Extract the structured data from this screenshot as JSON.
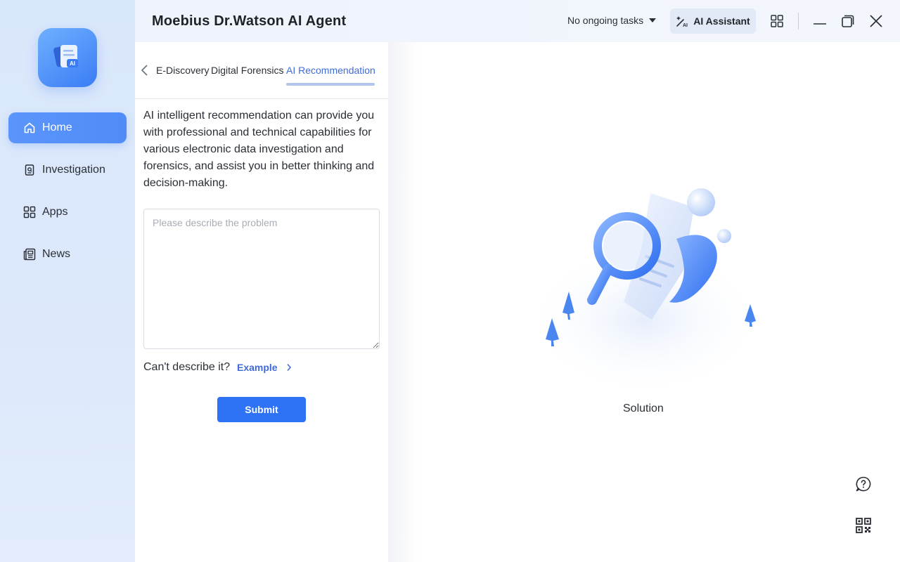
{
  "app": {
    "title": "Moebius Dr.Watson AI Agent"
  },
  "sidebar": {
    "logo_badge": "AI",
    "items": [
      {
        "label": "Home",
        "icon": "home-icon",
        "active": true
      },
      {
        "label": "Investigation",
        "icon": "investigation-icon"
      },
      {
        "label": "Apps",
        "icon": "apps-icon"
      },
      {
        "label": "News",
        "icon": "news-icon"
      }
    ]
  },
  "titlebar": {
    "tasks_label": "No ongoing tasks",
    "ai_assistant_label": "AI Assistant"
  },
  "panel": {
    "tabs": [
      {
        "label": "E-Discovery"
      },
      {
        "label": "Digital Forensics"
      },
      {
        "label": "AI Recommendation",
        "active": true
      }
    ],
    "description": "AI intelligent recommendation can provide you with professional and technical capabilities for various electronic data investigation and forensics, and assist you in better thinking and decision-making.",
    "problem_placeholder": "Please describe the problem",
    "problem_value": "",
    "cant_describe": "Can't describe it?",
    "example_label": "Example",
    "submit_label": "Submit"
  },
  "content": {
    "solution_label": "Solution"
  },
  "colors": {
    "accent": "#2e72f6",
    "active_tab": "#3f6bd8",
    "sidebar_bg": "#dde9fb"
  }
}
